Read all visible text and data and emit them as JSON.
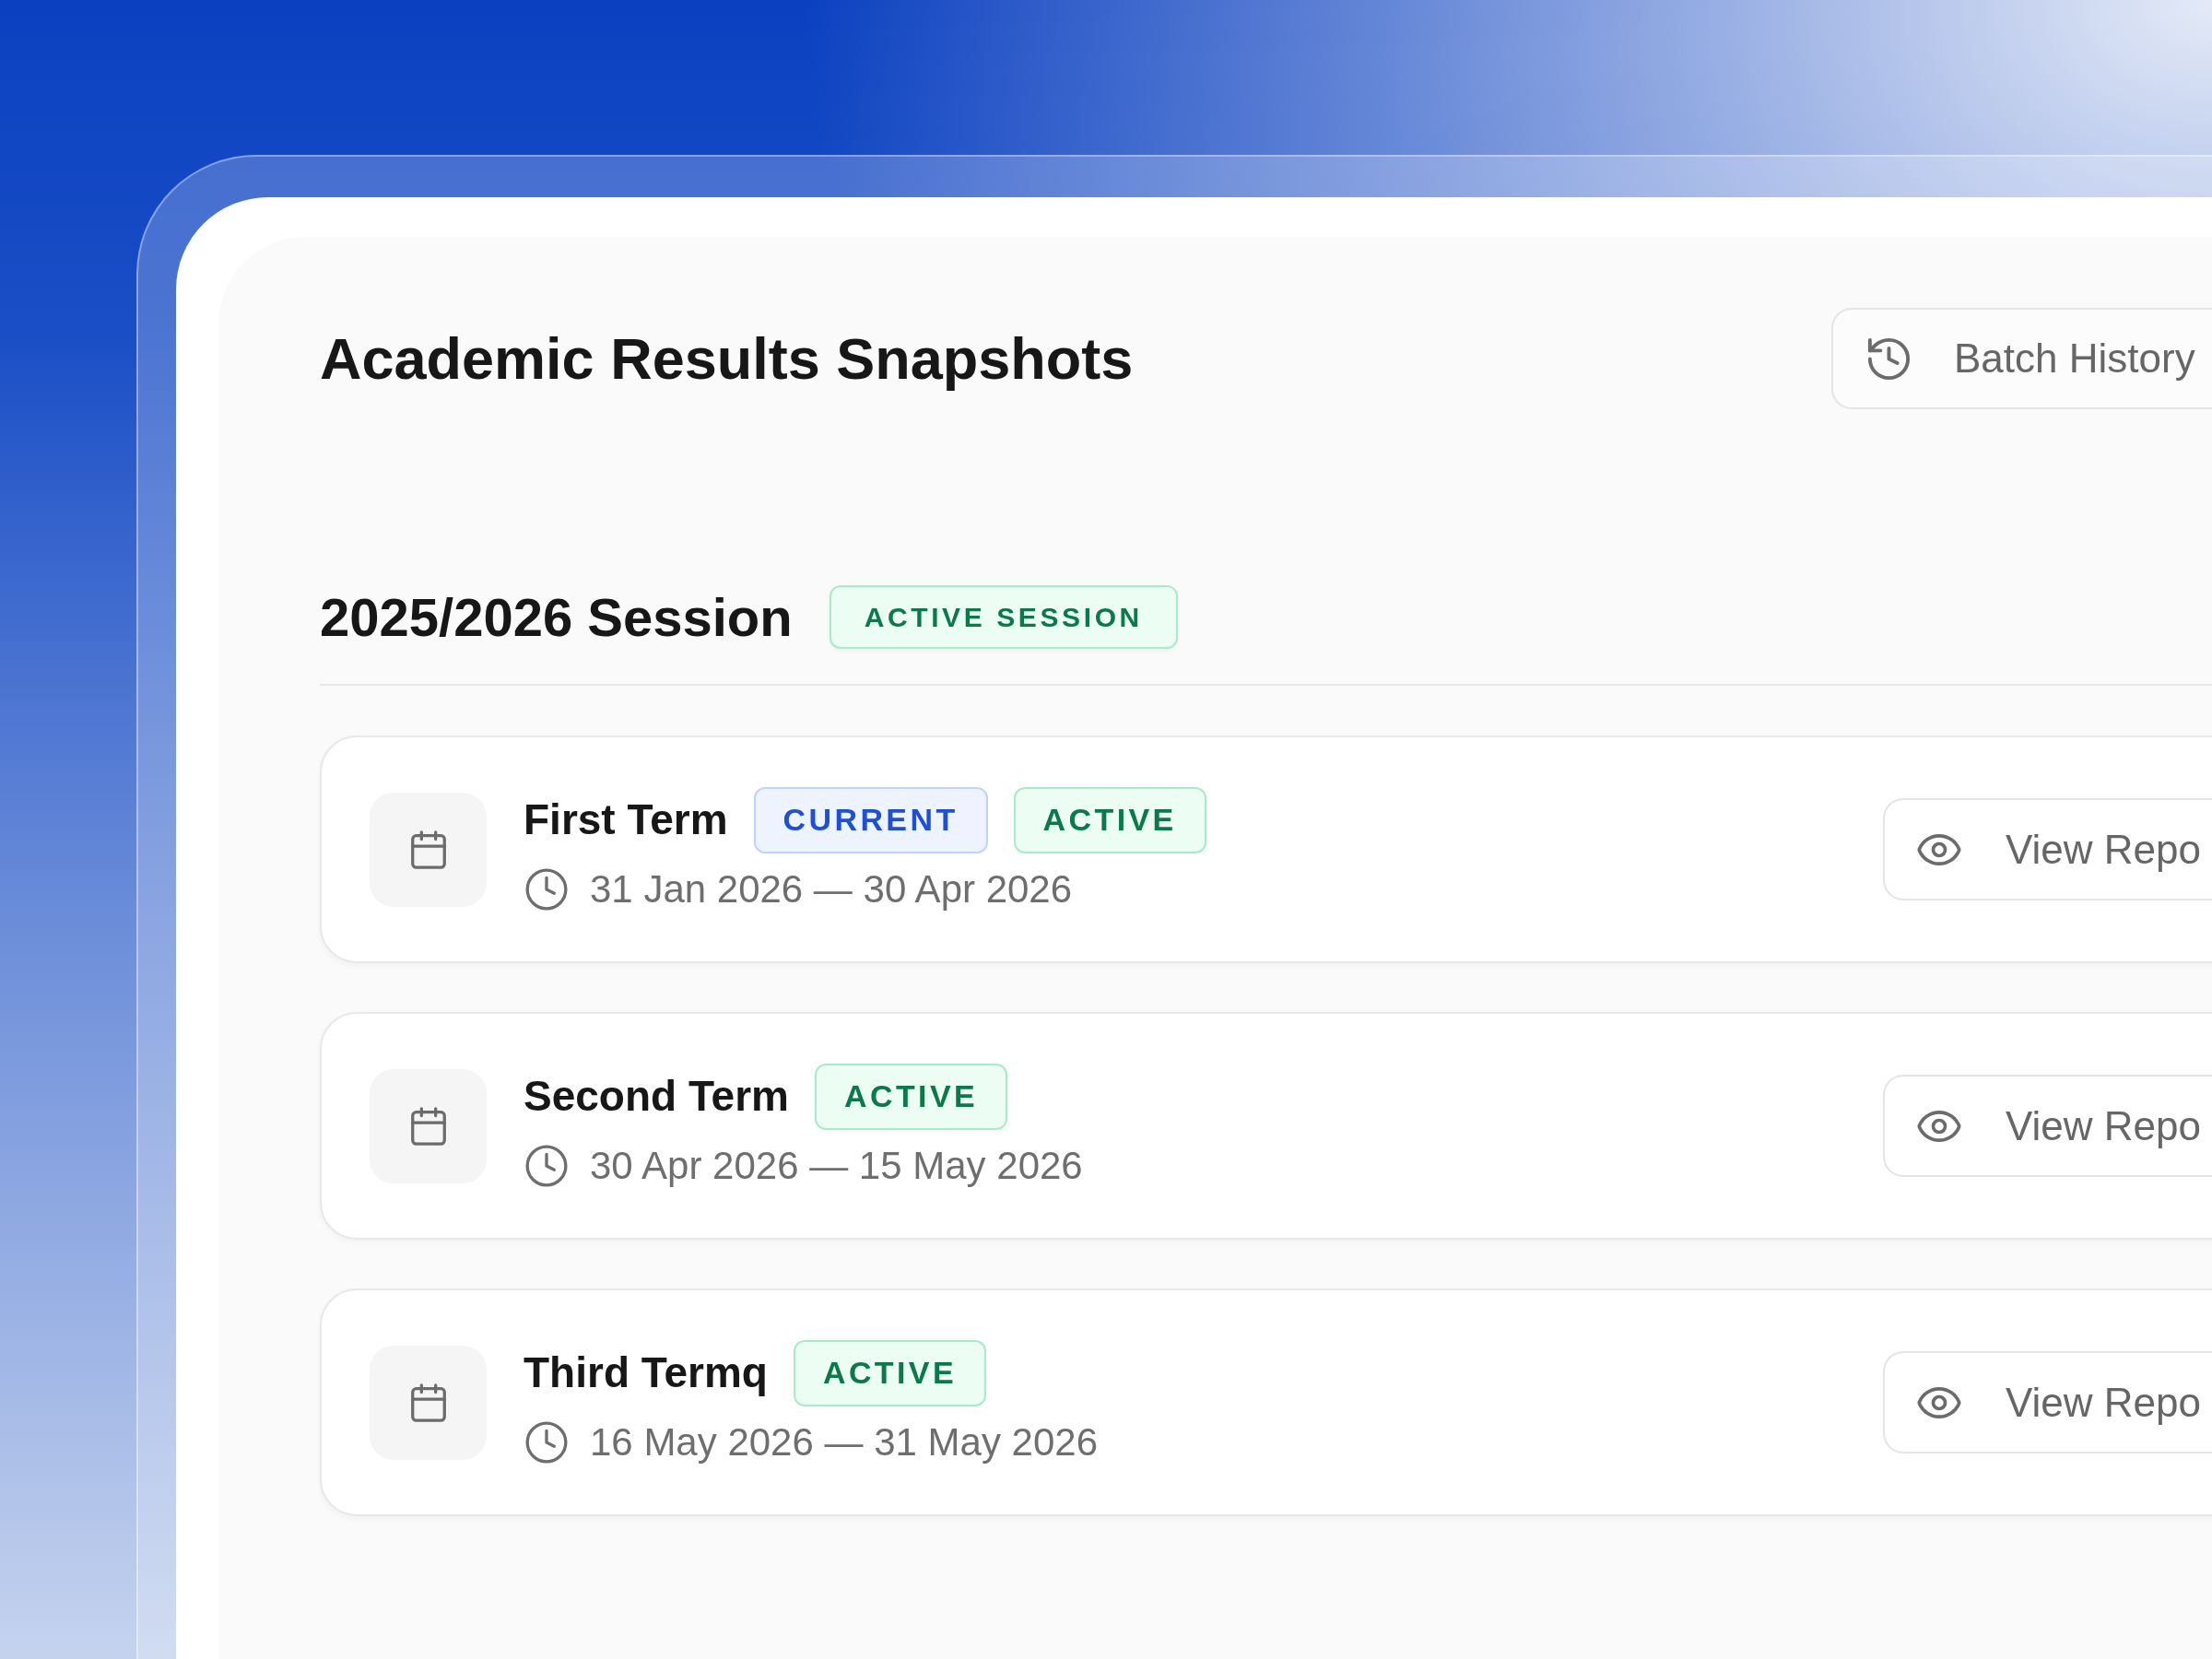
{
  "header": {
    "title": "Academic Results Snapshots",
    "history_button": {
      "label": "Batch History"
    }
  },
  "sessions": [
    {
      "title": "2025/2026 Session",
      "badge": {
        "label": "ACTIVE SESSION",
        "kind": "active"
      },
      "terms": [
        {
          "name": "First Term",
          "badges": [
            {
              "label": "CURRENT",
              "kind": "current"
            },
            {
              "label": "ACTIVE",
              "kind": "active"
            }
          ],
          "dates": "31 Jan 2026 — 30 Apr 2026",
          "action": "View Repo"
        },
        {
          "name": "Second Term",
          "badges": [
            {
              "label": "ACTIVE",
              "kind": "active"
            }
          ],
          "dates": "30 Apr 2026 — 15 May 2026",
          "action": "View Repo"
        },
        {
          "name": "Third Termq",
          "badges": [
            {
              "label": "ACTIVE",
              "kind": "active"
            }
          ],
          "dates": "16 May 2026 — 31 May 2026",
          "action": "View Repo"
        }
      ]
    }
  ]
}
